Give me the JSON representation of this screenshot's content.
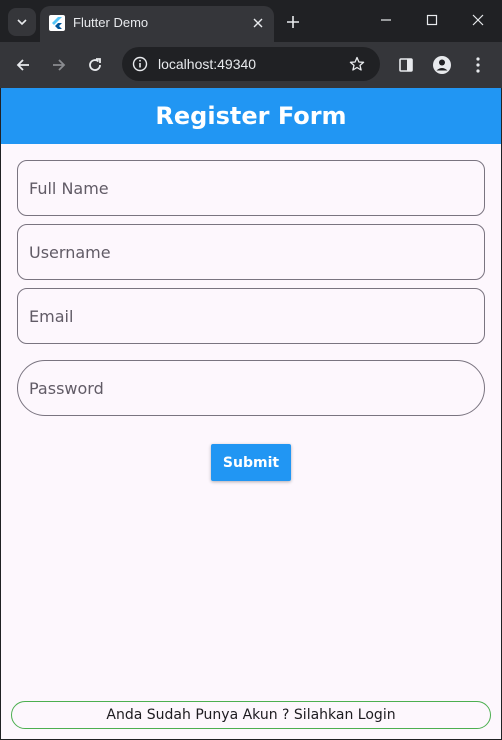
{
  "browser": {
    "tab_title": "Flutter Demo",
    "url": "localhost:49340",
    "icons": {
      "tab_search": "chevron-down-icon",
      "favicon": "flutter-icon",
      "tab_close": "close-icon",
      "new_tab": "plus-icon",
      "minimize": "minimize-icon",
      "maximize": "maximize-icon",
      "close_window": "close-icon",
      "back": "back-arrow-icon",
      "forward": "forward-arrow-icon",
      "reload": "reload-icon",
      "site_info": "info-icon",
      "bookmark": "star-icon",
      "side_panel": "side-panel-icon",
      "profile": "profile-icon",
      "menu": "kebab-menu-icon"
    }
  },
  "app": {
    "title": "Register Form",
    "accent_color": "#2196f3",
    "form": {
      "full_name_placeholder": "Full Name",
      "username_placeholder": "Username",
      "email_placeholder": "Email",
      "password_placeholder": "Password",
      "submit_label": "Submit"
    },
    "login_link": "Anda Sudah Punya Akun ? Silahkan Login"
  }
}
